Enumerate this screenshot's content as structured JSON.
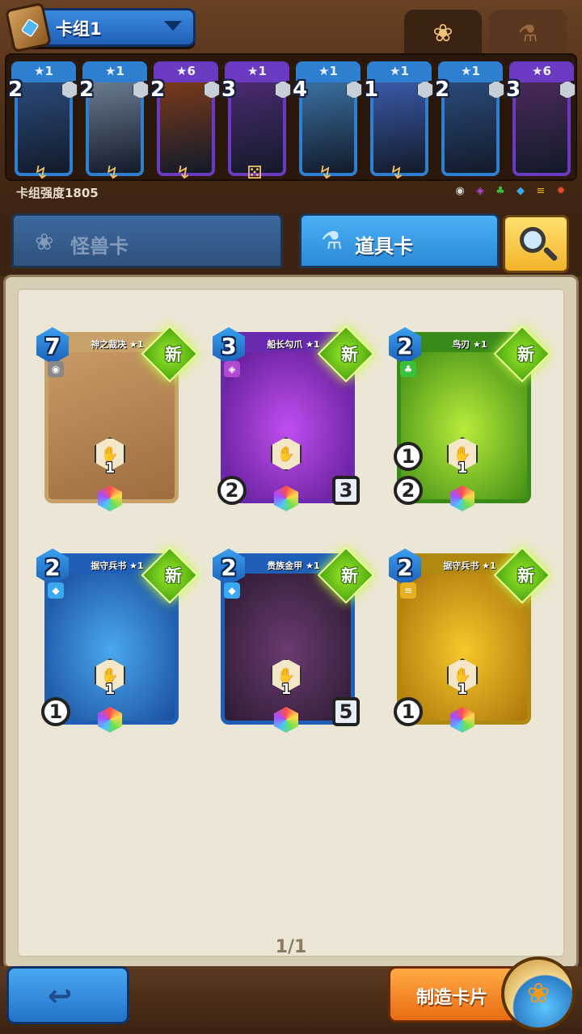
{
  "header": {
    "deck_name": "卡组1",
    "deck_power_label": "卡组强度1805",
    "top_tabs": [
      {
        "icon": "paw-icon",
        "active": true
      },
      {
        "icon": "flask-icon",
        "active": false
      }
    ]
  },
  "deck": [
    {
      "stars": "★1",
      "cost": "2",
      "frame": "#2f7fd0",
      "art": "#2a4a7a",
      "sub": "↯"
    },
    {
      "stars": "★1",
      "cost": "2",
      "frame": "#2f7fd0",
      "art": "#6a7b90",
      "sub": "↯"
    },
    {
      "stars": "★6",
      "cost": "2",
      "frame": "#6a3ac0",
      "art": "#7a3a1a",
      "sub": "↯"
    },
    {
      "stars": "★1",
      "cost": "3",
      "frame": "#6a3ac0",
      "art": "#4a2a70",
      "sub": "⚄"
    },
    {
      "stars": "★1",
      "cost": "4",
      "frame": "#2f7fd0",
      "art": "#3a70a0",
      "sub": "↯"
    },
    {
      "stars": "★1",
      "cost": "1",
      "frame": "#2f7fd0",
      "art": "#3a5aa8",
      "sub": "↯"
    },
    {
      "stars": "★1",
      "cost": "2",
      "frame": "#2f7fd0",
      "art": "#2a4a7a",
      "sub": ""
    },
    {
      "stars": "★6",
      "cost": "3",
      "frame": "#6a3ac0",
      "art": "#4a2a5a",
      "sub": ""
    }
  ],
  "element_icons": [
    {
      "name": "neutral-element-icon",
      "color": "#d8d8d8",
      "glyph": "◉"
    },
    {
      "name": "arcane-element-icon",
      "color": "#b04ad0",
      "glyph": "◈"
    },
    {
      "name": "nature-element-icon",
      "color": "#3ac03a",
      "glyph": "♣"
    },
    {
      "name": "water-element-icon",
      "color": "#3aa8f0",
      "glyph": "◆"
    },
    {
      "name": "earth-element-icon",
      "color": "#e8b020",
      "glyph": "≡"
    },
    {
      "name": "fire-element-icon",
      "color": "#e84a2a",
      "glyph": "✹"
    }
  ],
  "tabs": {
    "monster": "怪兽卡",
    "item": "道具卡"
  },
  "new_label": "新",
  "cards": [
    {
      "title": "神之裁决 ★1",
      "cost": "7",
      "frame": "#c8a06a",
      "art": "linear-gradient(160deg,#c79a66,#9c6b3e)",
      "center": "1",
      "left": "",
      "left2": "",
      "right": "",
      "elem": "◉",
      "elem_color": "#888"
    },
    {
      "title": "船长勾爪 ★1",
      "cost": "3",
      "frame": "#6a2ab0",
      "art": "radial-gradient(#c04ef0,#5a1a90)",
      "center": "",
      "left": "2",
      "left2": "",
      "right": "3",
      "elem": "◈",
      "elem_color": "#b04ad0"
    },
    {
      "title": "鸟刃 ★1",
      "cost": "2",
      "frame": "#3a8a1a",
      "art": "radial-gradient(#b8ec3a,#3c8a14)",
      "center": "1",
      "left": "2",
      "left2": "1",
      "right": "",
      "elem": "♣",
      "elem_color": "#3ac03a"
    },
    {
      "title": "据守兵书 ★1",
      "cost": "2",
      "frame": "#1f5fb8",
      "art": "radial-gradient(#4aa8ee,#184a98)",
      "center": "1",
      "left": "1",
      "left2": "",
      "right": "",
      "elem": "◆",
      "elem_color": "#3aa8f0"
    },
    {
      "title": "贵族金甲 ★1",
      "cost": "2",
      "frame": "#1f5fb8",
      "art": "radial-gradient(#6a3a70,#2a1a30)",
      "center": "1",
      "left": "",
      "left2": "",
      "right": "5",
      "elem": "◆",
      "elem_color": "#3aa8f0"
    },
    {
      "title": "据守兵书 ★1",
      "cost": "2",
      "frame": "#b08a10",
      "art": "radial-gradient(#f6c82a,#a8720a)",
      "center": "1",
      "left": "1",
      "left2": "",
      "right": "",
      "elem": "≡",
      "elem_color": "#e8b020"
    }
  ],
  "pager": "1/1",
  "bottom": {
    "craft_label": "制造卡片"
  }
}
